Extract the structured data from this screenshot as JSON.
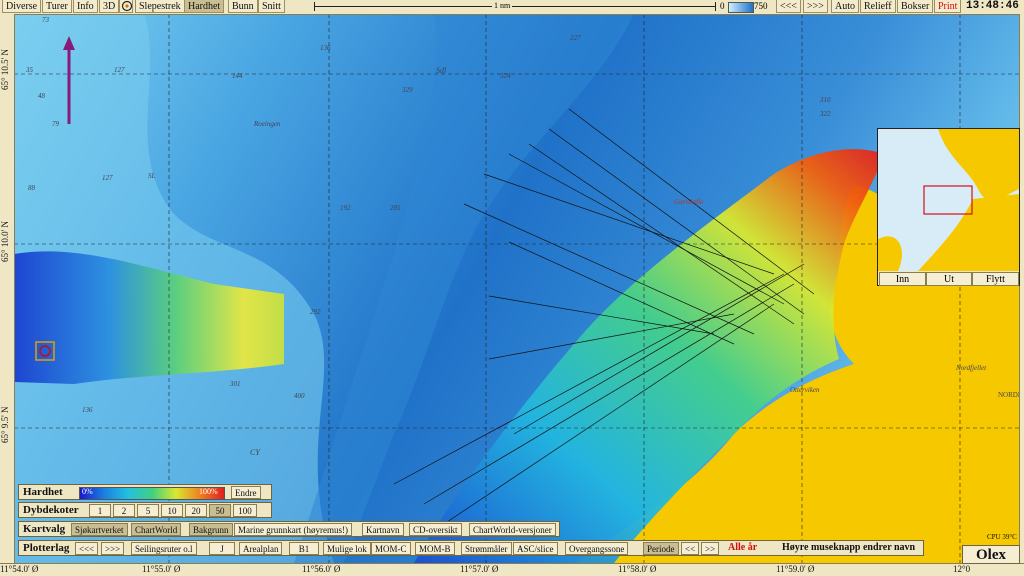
{
  "toolbar": {
    "items": [
      "Diverse",
      "Turer",
      "Info",
      "3D",
      "Slepestrek",
      "Hardhet",
      "Bunn",
      "Snitt"
    ],
    "scale_label": "1 nm",
    "depth_min": "0",
    "depth_max": "750",
    "nav_left": "<<<",
    "nav_right": ">>>",
    "auto": "Auto",
    "relief": "Relieff",
    "bokser": "Bokser",
    "print": "Print",
    "clock": "13:48:46"
  },
  "rulers": {
    "lat": [
      "65° 10.5' N",
      "65° 10.0' N",
      "65° 9.5' N"
    ],
    "lon": [
      "11°54.0' Ø",
      "11°55.0' Ø",
      "11°56.0' Ø",
      "11°57.0' Ø",
      "11°58.0' Ø",
      "11°59.0' Ø",
      "12°0"
    ]
  },
  "map_labels": {
    "roeingen": "Roeingen",
    "sl": "SL",
    "sdl": "Sdl",
    "cy": "CY",
    "otterviken": "Otterviken",
    "nordfjellet": "Nordfjellet",
    "nordp": "NORDP",
    "gurviksfloa": "Gurviksflo",
    "depths": [
      "73",
      "35",
      "127",
      "144",
      "48",
      "79",
      "88",
      "127",
      "136",
      "329",
      "322",
      "324",
      "227",
      "310",
      "192",
      "285",
      "292",
      "400",
      "301",
      "136"
    ]
  },
  "inset": {
    "btn_in": "Inn",
    "btn_out": "Ut",
    "btn_move": "Flytt"
  },
  "hardhet": {
    "label": "Hardhet",
    "min": "0%",
    "max": "100%",
    "edit": "Endre"
  },
  "dybdekoter": {
    "label": "Dybdekoter",
    "values": [
      "1",
      "2",
      "5",
      "10",
      "20",
      "50",
      "100"
    ],
    "selected": "50"
  },
  "kartvalg": {
    "label": "Kartvalg",
    "items": [
      "Sjøkartverket",
      "ChartWorld",
      "Bakgrunn",
      "Marine grunnkart (høyremus!)",
      "Kartnavn",
      "CD-oversikt",
      "ChartWorld-versjoner"
    ]
  },
  "plotterlag": {
    "label": "Plotterlag",
    "items": [
      "<<<",
      ">>>",
      "Seilingsruter o.l",
      "J",
      "Arealplan",
      "B1",
      "Mulige lok",
      "MOM-C",
      "MOM-B",
      "Strømmåler",
      "ASC/slice",
      "Overgangssone",
      "Periode",
      "<<",
      ">>"
    ],
    "all_years": "Alle år",
    "hint": "Høyre museknapp endrer navn"
  },
  "status": {
    "cpu": "CPU 39°C",
    "brand": "Olex"
  },
  "colors": {
    "deep": "#1f72c8",
    "shallow": "#7fd3f2",
    "land": "#f5c800",
    "accent_red": "#d21010",
    "purple": "#8a1a7a"
  }
}
